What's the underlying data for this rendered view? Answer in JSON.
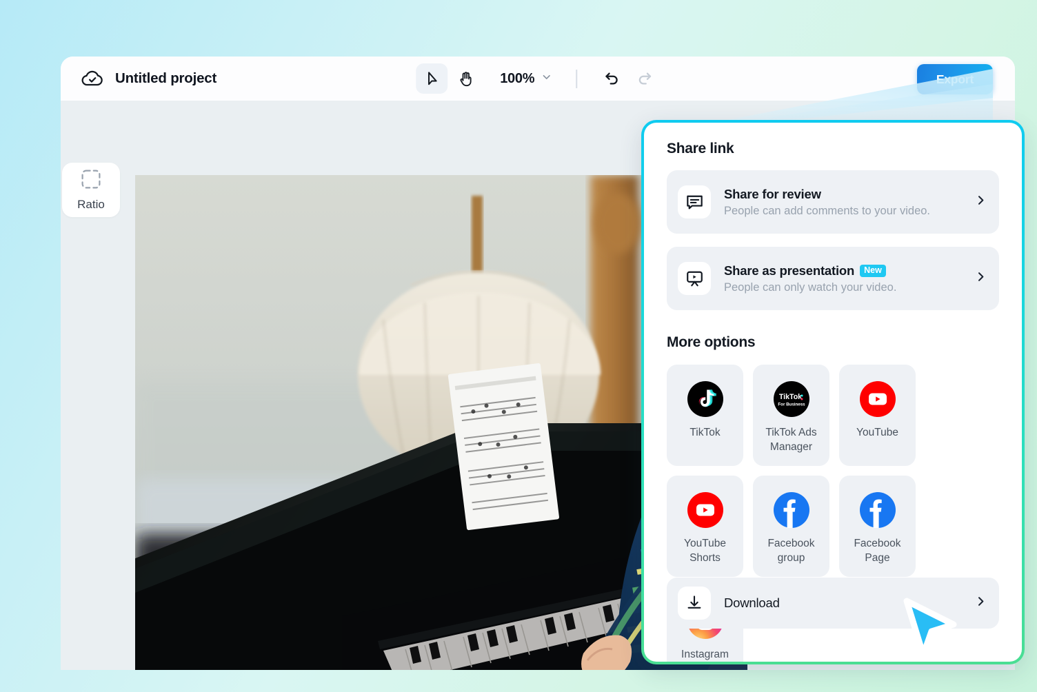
{
  "app": {
    "title": "Untitled project",
    "logo_icon": "cloud-check-icon"
  },
  "toolbar": {
    "select_tool": "cursor-tool",
    "hand_tool": "hand-tool",
    "zoom_level": "100%",
    "zoom_chevron": "chevron-down-icon",
    "undo": "undo-icon",
    "redo": "redo-icon",
    "export_label": "Export",
    "accent_blue": "#1e90e8"
  },
  "sidebar": {
    "ratio_label": "Ratio",
    "ratio_icon": "dashed-square-icon"
  },
  "canvas": {
    "media_description": "Boy playing an upright piano with sheet music and a lamp in the background"
  },
  "share_panel": {
    "border_gradient_from": "#0fcbf0",
    "border_gradient_to": "#4ade93",
    "heading": "Share link",
    "links": [
      {
        "icon": "comment-bubble-icon",
        "title": "Share for review",
        "subtitle": "People can add comments to your video.",
        "badge": "",
        "chevron": "chevron-right-icon"
      },
      {
        "icon": "presentation-play-icon",
        "title": "Share as presentation",
        "subtitle": "People can only watch your video.",
        "badge": "New",
        "chevron": "chevron-right-icon"
      }
    ],
    "more_heading": "More options",
    "tiles": [
      {
        "icon": "tiktok-icon",
        "label": "TikTok"
      },
      {
        "icon": "tiktok-ads-manager-icon",
        "label": "TikTok Ads Manager"
      },
      {
        "icon": "youtube-icon",
        "label": "YouTube"
      },
      {
        "icon": "youtube-shorts-icon",
        "label": "YouTube Shorts"
      },
      {
        "icon": "facebook-icon",
        "label": "Facebook group"
      },
      {
        "icon": "facebook-icon",
        "label": "Facebook Page"
      },
      {
        "icon": "instagram-icon",
        "label": "Instagram Reels"
      }
    ],
    "download": {
      "icon": "download-icon",
      "label": "Download",
      "chevron": "chevron-right-icon"
    }
  },
  "pointer": {
    "icon": "mouse-cursor-icon",
    "color": "#29bdf5"
  }
}
